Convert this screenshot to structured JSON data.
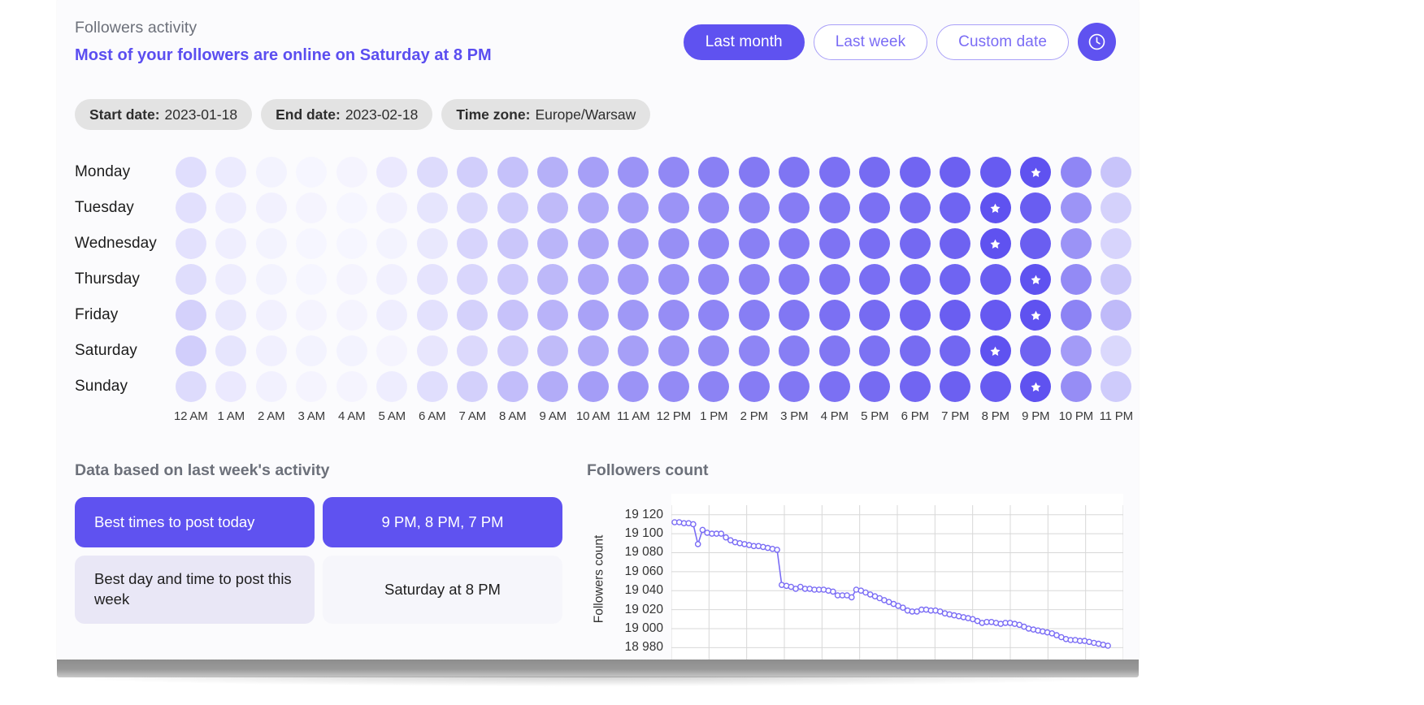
{
  "header": {
    "title": "Followers activity",
    "subtitle": "Most of your followers are online on Saturday at 8 PM",
    "range_buttons": [
      {
        "label": "Last month",
        "active": true
      },
      {
        "label": "Last week",
        "active": false
      },
      {
        "label": "Custom date",
        "active": false
      }
    ],
    "clock_icon": "clock-icon"
  },
  "filters": [
    {
      "key": "Start date:",
      "value": "2023-01-18"
    },
    {
      "key": "End date:",
      "value": "2023-02-18"
    },
    {
      "key": "Time zone:",
      "value": "Europe/Warsaw"
    }
  ],
  "heatmap": {
    "days": [
      "Monday",
      "Tuesday",
      "Wednesday",
      "Thursday",
      "Friday",
      "Saturday",
      "Sunday"
    ],
    "hours": [
      "12 AM",
      "1 AM",
      "2 AM",
      "3 AM",
      "4 AM",
      "5 AM",
      "6 AM",
      "7 AM",
      "8 AM",
      "9 AM",
      "10 AM",
      "11 AM",
      "12 PM",
      "1 PM",
      "2 PM",
      "3 PM",
      "4 PM",
      "5 PM",
      "6 PM",
      "7 PM",
      "8 PM",
      "9 PM",
      "10 PM",
      "11 PM"
    ],
    "max_value": 100,
    "base_color": "#5f52f0",
    "star_icon": "star-icon",
    "values": [
      [
        18,
        10,
        5,
        3,
        4,
        11,
        20,
        28,
        36,
        46,
        56,
        63,
        69,
        74,
        78,
        80,
        83,
        86,
        89,
        92,
        95,
        100,
        70,
        34
      ],
      [
        17,
        9,
        6,
        4,
        3,
        6,
        14,
        22,
        30,
        40,
        50,
        57,
        63,
        68,
        72,
        76,
        80,
        83,
        86,
        90,
        100,
        94,
        62,
        26
      ],
      [
        16,
        8,
        5,
        3,
        3,
        5,
        12,
        24,
        33,
        43,
        52,
        59,
        65,
        70,
        74,
        77,
        81,
        84,
        87,
        91,
        100,
        93,
        63,
        24
      ],
      [
        19,
        9,
        5,
        3,
        4,
        7,
        15,
        23,
        31,
        41,
        51,
        58,
        64,
        69,
        73,
        77,
        81,
        84,
        87,
        90,
        94,
        100,
        68,
        32
      ],
      [
        26,
        12,
        6,
        4,
        4,
        8,
        16,
        26,
        35,
        44,
        54,
        60,
        66,
        71,
        75,
        79,
        83,
        86,
        89,
        93,
        96,
        100,
        72,
        40
      ],
      [
        28,
        14,
        7,
        5,
        5,
        4,
        13,
        21,
        29,
        39,
        49,
        56,
        62,
        67,
        71,
        75,
        79,
        82,
        85,
        88,
        100,
        91,
        58,
        22
      ],
      [
        20,
        11,
        6,
        4,
        4,
        9,
        18,
        27,
        38,
        48,
        57,
        63,
        68,
        72,
        76,
        79,
        83,
        86,
        89,
        92,
        95,
        100,
        66,
        30
      ]
    ],
    "stars": [
      {
        "day": "Monday",
        "hour": "9 PM"
      },
      {
        "day": "Tuesday",
        "hour": "8 PM"
      },
      {
        "day": "Wednesday",
        "hour": "8 PM"
      },
      {
        "day": "Thursday",
        "hour": "9 PM"
      },
      {
        "day": "Friday",
        "hour": "9 PM"
      },
      {
        "day": "Saturday",
        "hour": "8 PM"
      },
      {
        "day": "Sunday",
        "hour": "9 PM"
      }
    ]
  },
  "insights": {
    "title": "Data based on last week's activity",
    "rows": [
      {
        "key": "Best times to post today",
        "value": "9 PM, 8 PM, 7 PM",
        "highlight": true
      },
      {
        "key": "Best day and time to post this week",
        "value": "Saturday at 8 PM",
        "highlight": false
      }
    ]
  },
  "chart_data": {
    "type": "line",
    "title": "Followers count",
    "xlabel": "",
    "ylabel": "Followers count",
    "ylim": [
      18970,
      19130
    ],
    "yticks": [
      19120,
      19100,
      19080,
      19060,
      19040,
      19020,
      19000,
      18980
    ],
    "ytick_labels": [
      "19 120",
      "19 100",
      "19 080",
      "19 060",
      "19 040",
      "19 020",
      "19 000",
      "18 980"
    ],
    "grid": true,
    "legend": "none",
    "marker": "circle-open",
    "line_color": "#7a6cf5",
    "series": [
      {
        "name": "Followers count",
        "values": [
          19112,
          19112,
          19111,
          19111,
          19110,
          19089,
          19104,
          19101,
          19100,
          19100,
          19100,
          19096,
          19093,
          19091,
          19090,
          19089,
          19088,
          19087,
          19087,
          19086,
          19085,
          19084,
          19083,
          19046,
          19045,
          19044,
          19042,
          19044,
          19042,
          19042,
          19041,
          19041,
          19041,
          19040,
          19039,
          19035,
          19035,
          19035,
          19033,
          19041,
          19040,
          19038,
          19036,
          19034,
          19032,
          19030,
          19028,
          19026,
          19024,
          19022,
          19019,
          19018,
          19018,
          19020,
          19020,
          19019,
          19019,
          19018,
          19016,
          19015,
          19014,
          19013,
          19012,
          19011,
          19010,
          19008,
          19006,
          19007,
          19007,
          19006,
          19005,
          19006,
          19006,
          19005,
          19004,
          19002,
          19000,
          18999,
          18998,
          18997,
          18996,
          18995,
          18993,
          18991,
          18989,
          18988,
          18988,
          18987,
          18987,
          18986,
          18985,
          18984,
          18983,
          18982
        ]
      }
    ]
  }
}
